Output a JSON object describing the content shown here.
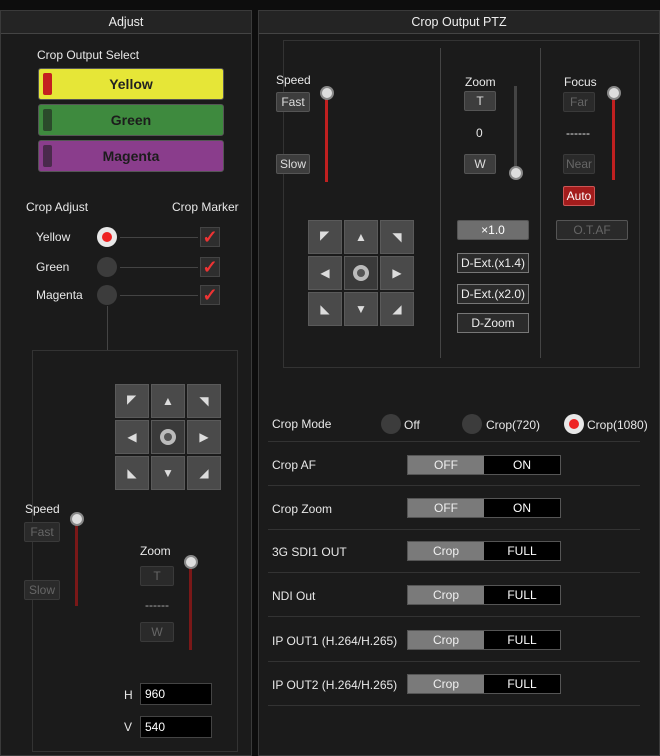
{
  "adjust": {
    "title": "Adjust",
    "crop_output_select_label": "Crop Output Select",
    "crop_outputs": [
      {
        "label": "Yellow",
        "bg": "#e6e637",
        "text": "#222",
        "tab": "#c42020"
      },
      {
        "label": "Green",
        "bg": "#3e8a3e",
        "text": "#1c1c1c",
        "tab": "#2b4a2b"
      },
      {
        "label": "Magenta",
        "bg": "#8a3d8c",
        "text": "#1c1c1c",
        "tab": "#4a2a4c"
      }
    ],
    "crop_adjust_label": "Crop Adjust",
    "crop_marker_label": "Crop Marker",
    "rows": [
      {
        "label": "Yellow",
        "selected": true,
        "marker": true
      },
      {
        "label": "Green",
        "selected": false,
        "marker": true
      },
      {
        "label": "Magenta",
        "selected": false,
        "marker": true
      }
    ],
    "check_glyph": "✓",
    "speed_label": "Speed",
    "fast_label": "Fast",
    "slow_label": "Slow",
    "zoom_label": "Zoom",
    "zoom_t": "T",
    "zoom_value": "------",
    "zoom_w": "W",
    "h_label": "H",
    "h_value": "960",
    "v_label": "V",
    "v_value": "540"
  },
  "ptz": {
    "title": "Crop Output PTZ",
    "speed_label": "Speed",
    "fast_label": "Fast",
    "slow_label": "Slow",
    "zoom_label": "Zoom",
    "zoom_t": "T",
    "zoom_value": "0",
    "zoom_w": "W",
    "focus_label": "Focus",
    "focus_far": "Far",
    "focus_value": "------",
    "focus_near": "Near",
    "focus_auto": "Auto",
    "otaf": "O.T.AF",
    "zoom_x1": "×1.0",
    "dext14": "D-Ext.(x1.4)",
    "dext20": "D-Ext.(x2.0)",
    "dzoom": "D-Zoom",
    "crop_mode_label": "Crop Mode",
    "crop_mode_options": [
      "Off",
      "Crop(720)",
      "Crop(1080)"
    ],
    "crop_mode_selected": "Crop(1080)",
    "settings": [
      {
        "label": "Crop AF",
        "left": "OFF",
        "right": "ON"
      },
      {
        "label": "Crop Zoom",
        "left": "OFF",
        "right": "ON"
      },
      {
        "label": "3G SDI1 OUT",
        "left": "Crop",
        "right": "FULL"
      },
      {
        "label": "NDI Out",
        "left": "Crop",
        "right": "FULL"
      },
      {
        "label": "IP OUT1 (H.264/H.265)",
        "left": "Crop",
        "right": "FULL"
      },
      {
        "label": "IP OUT2 (H.264/H.265)",
        "left": "Crop",
        "right": "FULL"
      }
    ]
  },
  "arrows": {
    "up": "▲",
    "down": "▼",
    "left": "◀",
    "right": "▶",
    "ul": "◤",
    "ur": "◥",
    "dl": "◣",
    "dr": "◢"
  },
  "colors": {
    "accent_red": "#c02020",
    "panel_bg": "#1b1b1b"
  }
}
